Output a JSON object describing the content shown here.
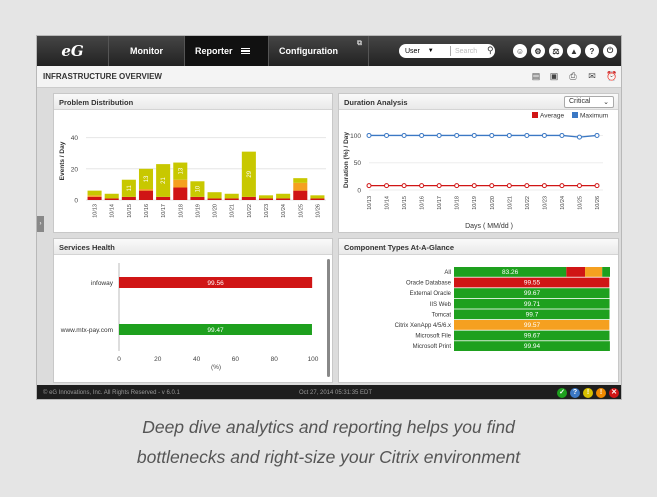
{
  "nav": {
    "logo": "eG",
    "tabs": [
      "Monitor",
      "Reporter",
      "Configuration"
    ],
    "user_select": "User",
    "search_placeholder": "Search",
    "icons": [
      "user-icon",
      "settings-icon",
      "admin-icon",
      "alert-icon",
      "help-icon",
      "power-icon"
    ]
  },
  "page": {
    "title": "INFRASTRUCTURE OVERVIEW"
  },
  "panels": {
    "problem_distribution": "Problem Distribution",
    "duration_analysis": "Duration Analysis",
    "services_health": "Services Health",
    "component_types": "Component Types At-A-Glance"
  },
  "duration_filter": "Critical",
  "footer": {
    "copyright": "© eG Innovations, Inc. All Rights Reserved - v 6.0.1",
    "datetime": "Oct 27, 2014 05:31:35 EDT"
  },
  "caption": [
    "Deep dive analytics and reporting helps you find",
    "bottlenecks and right-size your Citrix environment"
  ],
  "colors": {
    "critical": "#d01515",
    "major": "#f5a020",
    "minor": "#c8c800",
    "normal": "#1ea01e",
    "blue": "#3b78c4"
  },
  "chart_data": [
    {
      "type": "bar",
      "title": "Problem Distribution",
      "ylabel": "Events / Day",
      "ylim": [
        0,
        50
      ],
      "yticks": [
        0,
        20,
        40
      ],
      "categories": [
        "10/13",
        "10/14",
        "10/15",
        "10/16",
        "10/17",
        "10/18",
        "10/19",
        "10/20",
        "10/21",
        "10/22",
        "10/23",
        "10/24",
        "10/25",
        "10/26"
      ],
      "series": [
        {
          "name": "Critical",
          "color": "#d01515",
          "values": [
            2,
            1,
            2,
            6,
            2,
            8,
            2,
            1,
            1,
            2,
            1,
            1,
            6,
            1
          ]
        },
        {
          "name": "Major",
          "color": "#f5a020",
          "values": [
            1,
            0,
            0,
            1,
            0,
            5,
            0,
            0,
            0,
            0,
            0,
            0,
            5,
            0
          ]
        },
        {
          "name": "Minor",
          "color": "#c8c800",
          "values": [
            3,
            3,
            11,
            13,
            21,
            11,
            10,
            4,
            3,
            29,
            2,
            3,
            3,
            2
          ]
        }
      ],
      "bar_labels": [
        null,
        null,
        "11",
        "13",
        "21",
        "13",
        "10",
        null,
        null,
        "29",
        null,
        null,
        null,
        null
      ]
    },
    {
      "type": "line",
      "title": "Duration Analysis",
      "ylabel": "Duration (%) / Day",
      "xlabel": "Days ( MM/dd )",
      "ylim": [
        0,
        110
      ],
      "yticks": [
        0,
        50,
        100
      ],
      "legend": "top-right",
      "categories": [
        "10/13",
        "10/14",
        "10/15",
        "10/16",
        "10/17",
        "10/18",
        "10/19",
        "10/20",
        "10/21",
        "10/22",
        "10/23",
        "10/24",
        "10/25",
        "10/26"
      ],
      "series": [
        {
          "name": "Average",
          "color": "#d01515",
          "values": [
            8,
            8,
            8,
            8,
            8,
            8,
            8,
            8,
            8,
            8,
            8,
            8,
            8,
            8
          ]
        },
        {
          "name": "Maximum",
          "color": "#3b78c4",
          "values": [
            100,
            100,
            100,
            100,
            100,
            100,
            100,
            100,
            100,
            100,
            100,
            100,
            97,
            100
          ]
        }
      ]
    },
    {
      "type": "bar",
      "orientation": "horizontal",
      "title": "Services Health",
      "xlabel": "(%)",
      "xlim": [
        0,
        100
      ],
      "xticks": [
        0,
        20,
        40,
        60,
        80,
        100
      ],
      "categories": [
        "infoway",
        "www.mtx-pay.com"
      ],
      "values": [
        99.56,
        99.47
      ],
      "colors": [
        "#d01515",
        "#1ea01e"
      ]
    },
    {
      "type": "bar",
      "orientation": "horizontal",
      "title": "Component Types At-A-Glance",
      "categories": [
        "All",
        "Oracle Database",
        "External Oracle",
        "IIS Web",
        "Tomcat",
        "Citrix XenApp 4/5/6.x",
        "Microsoft File",
        "Microsoft Print"
      ],
      "values": [
        83.26,
        99.55,
        99.67,
        99.71,
        99.7,
        99.57,
        99.67,
        99.94
      ],
      "colors": [
        "#1ea01e",
        "#d01515",
        "#1ea01e",
        "#1ea01e",
        "#1ea01e",
        "#f5a020",
        "#1ea01e",
        "#1ea01e"
      ],
      "all_breakdown": [
        {
          "status": "normal",
          "share": 0.72,
          "color": "#1ea01e"
        },
        {
          "status": "critical",
          "share": 0.12,
          "color": "#d01515"
        },
        {
          "status": "major",
          "share": 0.11,
          "color": "#f5a020"
        },
        {
          "status": "normal",
          "share": 0.05,
          "color": "#1ea01e"
        }
      ]
    }
  ]
}
